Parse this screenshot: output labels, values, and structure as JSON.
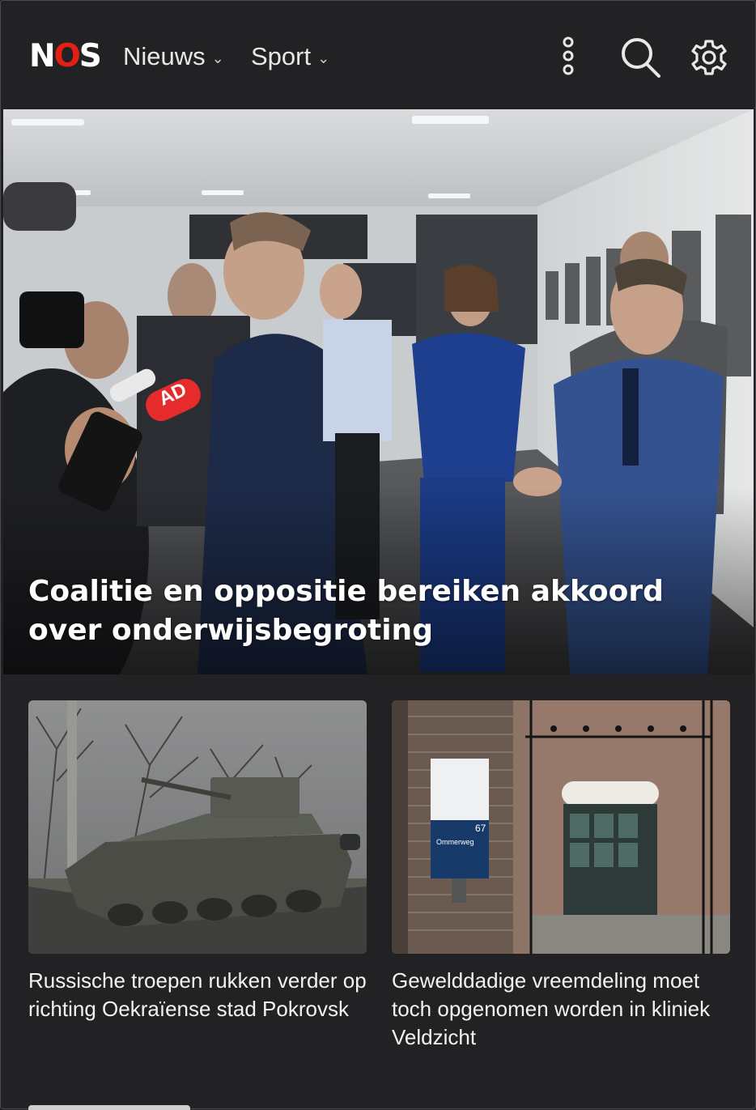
{
  "header": {
    "logo": {
      "n": "N",
      "o": "O",
      "s": "S"
    },
    "nav": [
      {
        "label": "Nieuws",
        "chevron": "⌄"
      },
      {
        "label": "Sport",
        "chevron": "⌄"
      }
    ],
    "icons": [
      "more-icon",
      "search-icon",
      "gear-icon"
    ],
    "logo_accent_color": "#e61e14"
  },
  "hero": {
    "title": "Coalitie en oppositie bereiken akkoord over onderwijsbegroting"
  },
  "articles": [
    {
      "title": "Russische troepen rukken verder op richting Oekraïense stad Pokrovsk"
    },
    {
      "title": "Gewelddadige vreemdeling moet toch opgenomen worden in kliniek Veldzicht"
    }
  ],
  "photo_text": {
    "microphone_brand": "AD",
    "sign_name": "Ommerweg",
    "sign_number": "67"
  }
}
